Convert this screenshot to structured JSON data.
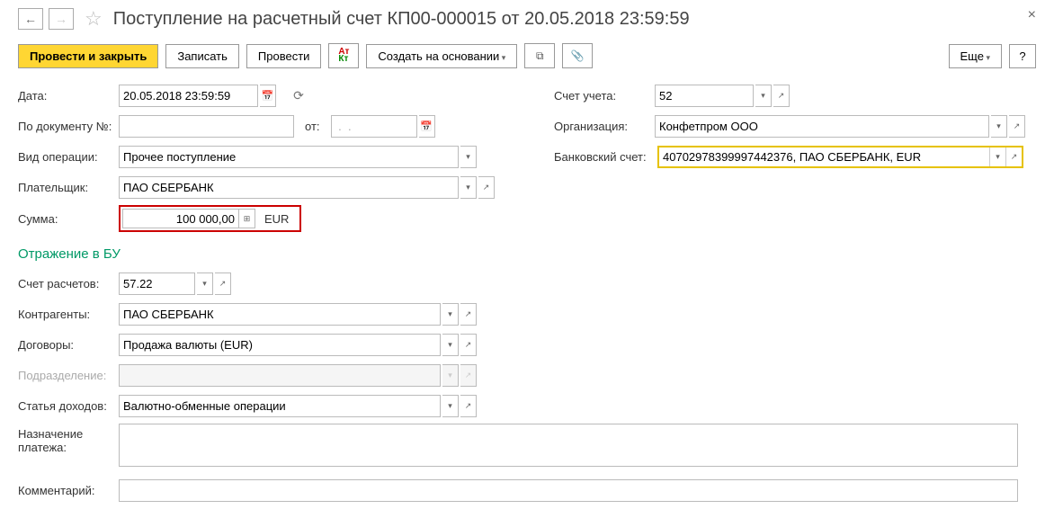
{
  "header": {
    "title": "Поступление на расчетный счет КП00-000015 от 20.05.2018 23:59:59"
  },
  "toolbar": {
    "post_close": "Провести и закрыть",
    "save": "Записать",
    "post": "Провести",
    "create_based": "Создать на основании",
    "more": "Еще",
    "help": "?"
  },
  "left": {
    "date_label": "Дата:",
    "date_value": "20.05.2018 23:59:59",
    "docnum_label": "По документу №:",
    "docnum_value": "",
    "ot_label": "от:",
    "ot_value": " .  .    ",
    "optype_label": "Вид операции:",
    "optype_value": "Прочее поступление",
    "payer_label": "Плательщик:",
    "payer_value": "ПАО СБЕРБАНК",
    "sum_label": "Сумма:",
    "sum_value": "100 000,00",
    "currency": "EUR",
    "section": "Отражение в БУ",
    "account_label": "Счет расчетов:",
    "account_value": "57.22",
    "counterparty_label": "Контрагенты:",
    "counterparty_value": "ПАО СБЕРБАНК",
    "contract_label": "Договоры:",
    "contract_value": "Продажа валюты (EUR)",
    "subdiv_label": "Подразделение:",
    "subdiv_value": "",
    "income_label": "Статья доходов:",
    "income_value": "Валютно-обменные операции",
    "purpose_label": "Назначение платежа:",
    "purpose_value": "",
    "comment_label": "Комментарий:",
    "comment_value": ""
  },
  "right": {
    "account_label": "Счет учета:",
    "account_value": "52",
    "org_label": "Организация:",
    "org_value": "Конфетпром ООО",
    "bank_label": "Банковский счет:",
    "bank_value": "40702978399997442376, ПАО СБЕРБАНК, EUR"
  }
}
